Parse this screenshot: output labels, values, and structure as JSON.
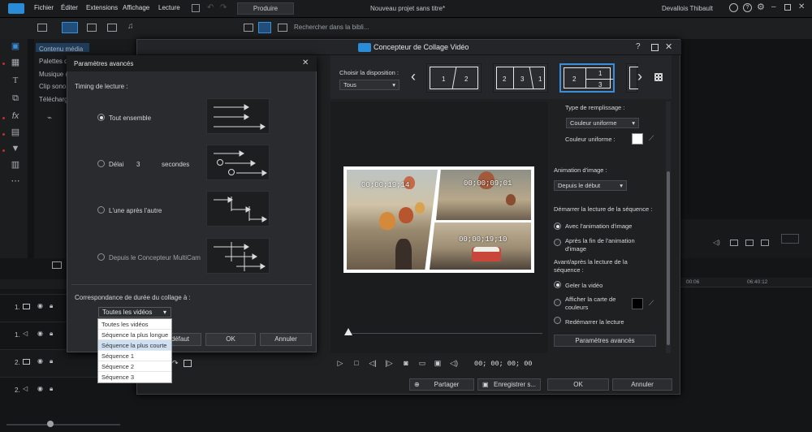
{
  "app": {
    "menu": [
      "Fichier",
      "Éditer",
      "Extensions",
      "Affichage",
      "Lecture"
    ],
    "produce_label": "Produire",
    "project_title": "Nouveau projet sans titre*",
    "user_name": "Devallois Thibault",
    "search_placeholder": "Rechercher dans la bibli...",
    "media_items": [
      "Contenu média",
      "Palettes d",
      "Musique d",
      "Clip sono",
      "Télécharg"
    ],
    "timeline_time_left": "00:06",
    "timeline_time_right": "06:40:12",
    "track_labels": [
      "1.",
      "1.",
      "2.",
      "2."
    ]
  },
  "collage": {
    "title": "Concepteur de Collage Vidéo",
    "layout_label": "Choisir la disposition :",
    "layout_filter": "Tous",
    "layouts": [
      {
        "cells": [
          "1",
          "2"
        ]
      },
      {
        "cells": [
          "2",
          "3",
          "1"
        ]
      },
      {
        "cells": [
          "2",
          "1",
          "3"
        ]
      }
    ],
    "timecodes": [
      "00;00;19;14",
      "00;00;09;01",
      "00;00;19;10"
    ],
    "player_time": "00; 00; 00; 00",
    "fill_type_label": "Type de remplissage :",
    "fill_type_value": "Couleur uniforme",
    "uniform_color_label": "Couleur uniforme :",
    "image_anim_label": "Animation d'image :",
    "image_anim_value": "Depuis le début",
    "start_seq_label": "Démarrer la lecture de la séquence :",
    "start_options": [
      "Avec l'animation d'image",
      "Après la fin de l'animation d'image"
    ],
    "before_after_label": "Avant/après la lecture de la séquence :",
    "after_options": [
      "Geler la vidéo",
      "Afficher la carte de couleurs",
      "Redémarrer la lecture"
    ],
    "advanced_button": "Paramètres avancés",
    "footer_buttons": [
      "Partager",
      "Enregistrer s...",
      "OK",
      "Annuler"
    ]
  },
  "advanced": {
    "title": "Paramètres avancés",
    "timing_label": "Timing de lecture :",
    "option_all": "Tout ensemble",
    "option_delay_pre": "Délai",
    "option_delay_value": "3",
    "option_delay_post": "secondes",
    "option_sequential": "L'une après l'autre",
    "option_multicam": "Depuis le Concepteur MultiCam",
    "duration_label": "Correspondance de durée du collage à :",
    "duration_value": "Toutes les vidéos",
    "duration_options": [
      "Toutes les vidéos",
      "Séquence la plus longue",
      "Séquence la plus courte",
      "Séquence 1",
      "Séquence 2",
      "Séquence 3"
    ],
    "selected_option_index": 2,
    "default_button": "défaut",
    "ok_button": "OK",
    "cancel_button": "Annuler"
  }
}
